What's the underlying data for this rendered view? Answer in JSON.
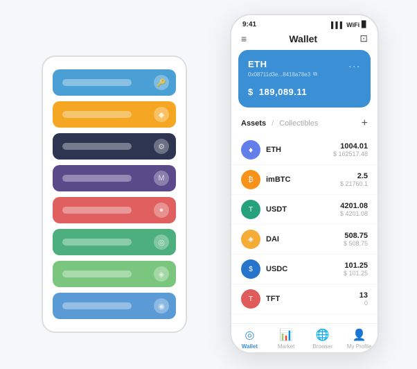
{
  "background": {
    "cards": [
      {
        "color": "card-blue",
        "text": "",
        "icon": "🔑"
      },
      {
        "color": "card-orange",
        "text": "",
        "icon": "◆"
      },
      {
        "color": "card-dark",
        "text": "",
        "icon": "⚙"
      },
      {
        "color": "card-purple",
        "text": "",
        "icon": "M"
      },
      {
        "color": "card-red",
        "text": "",
        "icon": "●"
      },
      {
        "color": "card-green",
        "text": "",
        "icon": "◎"
      },
      {
        "color": "card-lightgreen",
        "text": "",
        "icon": "◈"
      },
      {
        "color": "card-lightblue",
        "text": "",
        "icon": "◉"
      }
    ]
  },
  "phone": {
    "status": {
      "time": "9:41",
      "signal": "▌▌▌",
      "wifi": "WiFi",
      "battery": "🔋"
    },
    "header": {
      "menu_icon": "≡",
      "title": "Wallet",
      "scan_icon": "⊡"
    },
    "eth_card": {
      "label": "ETH",
      "dots": "...",
      "address": "0x08711d3e...8418a78e3",
      "copy_symbol": "⧉",
      "balance_prefix": "$",
      "balance": "189,089.11"
    },
    "assets": {
      "tab_active": "Assets",
      "tab_divider": "/",
      "tab_inactive": "Collectibles",
      "add_icon": "+"
    },
    "asset_list": [
      {
        "name": "ETH",
        "icon": "♦",
        "icon_class": "icon-eth",
        "qty": "1004.01",
        "usd": "$ 162517.48"
      },
      {
        "name": "imBTC",
        "icon": "₿",
        "icon_class": "icon-imbtc",
        "qty": "2.5",
        "usd": "$ 21760.1"
      },
      {
        "name": "USDT",
        "icon": "T",
        "icon_class": "icon-usdt",
        "qty": "4201.08",
        "usd": "$ 4201.08"
      },
      {
        "name": "DAI",
        "icon": "◈",
        "icon_class": "icon-dai",
        "qty": "508.75",
        "usd": "$ 508.75"
      },
      {
        "name": "USDC",
        "icon": "$",
        "icon_class": "icon-usdc",
        "qty": "101.25",
        "usd": "$ 101.25"
      },
      {
        "name": "TFT",
        "icon": "T",
        "icon_class": "icon-tft",
        "qty": "13",
        "usd": "0"
      }
    ],
    "bottom_nav": [
      {
        "icon": "◎",
        "label": "Wallet",
        "active": true
      },
      {
        "icon": "📊",
        "label": "Market",
        "active": false
      },
      {
        "icon": "🌐",
        "label": "Browser",
        "active": false
      },
      {
        "icon": "👤",
        "label": "My Profile",
        "active": false
      }
    ]
  }
}
